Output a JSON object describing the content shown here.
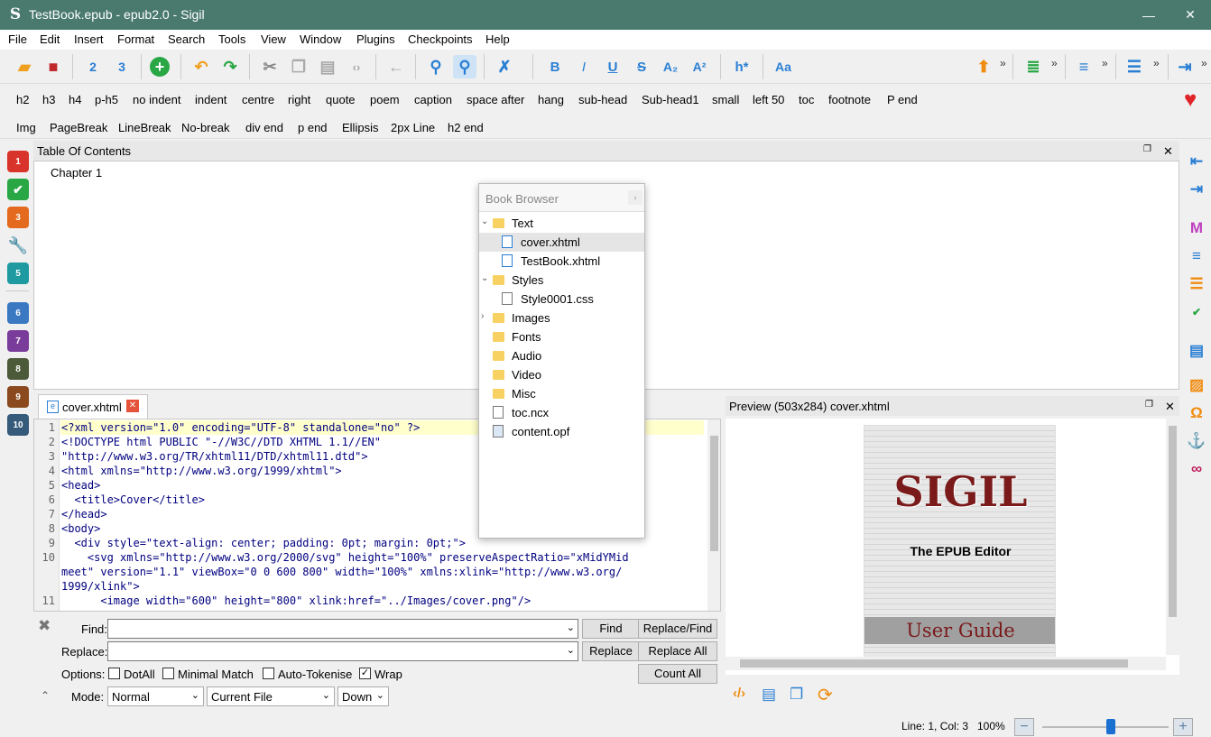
{
  "window": {
    "title": "TestBook.epub - epub2.0 - Sigil",
    "min": "—",
    "max": "☐",
    "close": "✕"
  },
  "menu": [
    "File",
    "Edit",
    "Insert",
    "Format",
    "Search",
    "Tools",
    "View",
    "Window",
    "Plugins",
    "Checkpoints",
    "Help"
  ],
  "clipbar1": [
    "h2",
    "h3",
    "h4",
    "p-h5",
    "no indent",
    "indent",
    "centre",
    "right",
    "quote",
    "poem",
    "caption",
    "space after",
    "hang",
    "sub-head",
    "Sub-head1",
    "small",
    "left 50",
    "toc",
    "footnote",
    "P end"
  ],
  "clipbar2": [
    "Img",
    "PageBreak",
    "LineBreak",
    "No-break",
    "div end",
    "p end",
    "Ellipsis",
    "2px Line",
    "h2 end"
  ],
  "toolbar": {
    "heading_label": "h*",
    "case_label": "Aa",
    "bold": "B",
    "italic": "I",
    "underline": "U",
    "strike": "S",
    "sub": "A₂",
    "sup": "A²"
  },
  "puzzles": [
    "1",
    "",
    "3",
    "",
    "5",
    "6",
    "7",
    "8",
    "9",
    "10"
  ],
  "toc": {
    "title": "Table Of Contents",
    "items": [
      "Chapter 1"
    ]
  },
  "book_browser": {
    "title": "Book Browser",
    "items": [
      {
        "label": "Text",
        "kind": "folder",
        "expanded": "open"
      },
      {
        "label": "cover.xhtml",
        "kind": "xhtml",
        "selected": true
      },
      {
        "label": "TestBook.xhtml",
        "kind": "xhtml"
      },
      {
        "label": "Styles",
        "kind": "folder",
        "expanded": "open"
      },
      {
        "label": "Style0001.css",
        "kind": "css"
      },
      {
        "label": "Images",
        "kind": "folder",
        "expanded": "closed"
      },
      {
        "label": "Fonts",
        "kind": "folder"
      },
      {
        "label": "Audio",
        "kind": "folder"
      },
      {
        "label": "Video",
        "kind": "folder"
      },
      {
        "label": "Misc",
        "kind": "folder"
      },
      {
        "label": "toc.ncx",
        "kind": "file"
      },
      {
        "label": "content.opf",
        "kind": "opf"
      }
    ]
  },
  "editor": {
    "tab": "cover.xhtml",
    "line_numbers": [
      "1",
      "2",
      "3",
      "4",
      "5",
      "6",
      "7",
      "8",
      "9",
      "10",
      "",
      "",
      "11"
    ],
    "lines": [
      "<?xml version=\"1.0\" encoding=\"UTF-8\" standalone=\"no\" ?>",
      "<!DOCTYPE html PUBLIC \"-//W3C//DTD XHTML 1.1//EN\"",
      "\"http://www.w3.org/TR/xhtml11/DTD/xhtml11.dtd\">",
      "<html xmlns=\"http://www.w3.org/1999/xhtml\">",
      "<head>",
      "  <title>Cover</title>",
      "</head>",
      "<body>",
      "  <div style=\"text-align: center; padding: 0pt; margin: 0pt;\">",
      "    <svg xmlns=\"http://www.w3.org/2000/svg\" height=\"100%\" preserveAspectRatio=\"xMidYMid",
      "meet\" version=\"1.1\" viewBox=\"0 0 600 800\" width=\"100%\" xmlns:xlink=\"http://www.w3.org/",
      "1999/xlink\">",
      "      <image width=\"600\" height=\"800\" xlink:href=\"../Images/cover.png\"/>"
    ]
  },
  "find": {
    "find_label": "Find:",
    "replace_label": "Replace:",
    "options_label": "Options:",
    "mode_label": "Mode:",
    "find_btn": "Find",
    "replace_find_btn": "Replace/Find",
    "replace_btn": "Replace",
    "replace_all_btn": "Replace All",
    "count_all_btn": "Count All",
    "opt_dotall": "DotAll",
    "opt_minimal": "Minimal Match",
    "opt_autotok": "Auto-Tokenise",
    "opt_wrap": "Wrap",
    "mode": "Normal",
    "scope": "Current File",
    "direction": "Down"
  },
  "preview": {
    "title": "Preview (503x284) cover.xhtml",
    "cover_title": "SIGIL",
    "cover_sub": "The EPUB Editor",
    "cover_band": "User Guide"
  },
  "status": {
    "position": "Line: 1, Col: 3",
    "zoom": "100%",
    "zoom_level": 0.76
  }
}
